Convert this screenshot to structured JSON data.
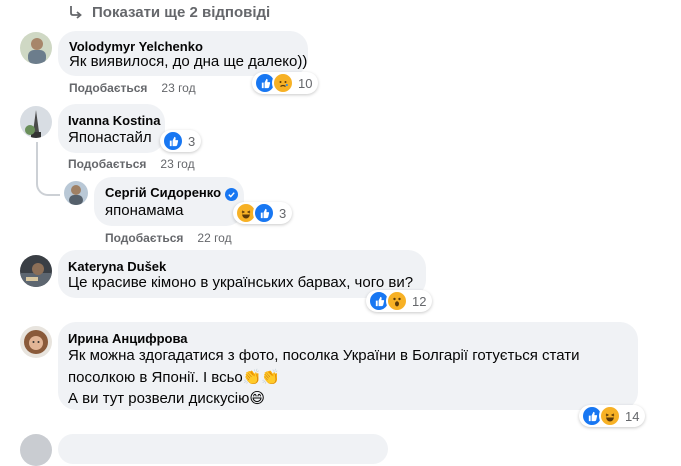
{
  "show_replies": {
    "label": "Показати ще 2 відповіді",
    "icon": "reply-arrow-icon"
  },
  "comments": [
    {
      "author": "Volodymyr Yelchenko",
      "text": "Як виявилося, до дна ще далеко))",
      "reactions": [
        "like",
        "sad"
      ],
      "count": "10",
      "like_label": "Подобається",
      "time": "23 год"
    },
    {
      "author": "Ivanna Kostina",
      "text": "Японастайл",
      "reactions": [
        "like"
      ],
      "count": "3",
      "like_label": "Подобається",
      "time": "23 год"
    },
    {
      "author": "Сергій Сидоренко",
      "verified": true,
      "text": "японамама",
      "reactions": [
        "haha",
        "like"
      ],
      "count": "3",
      "like_label": "Подобається",
      "time": "22 год"
    },
    {
      "author": "Kateryna Dušek",
      "text": "Це красиве кімоно в українських барвах, чого ви?",
      "reactions": [
        "like",
        "wow"
      ],
      "count": "12"
    },
    {
      "author": "Ирина Анцифрова",
      "text_lines": [
        "Як можна здогадатися з фото, посолка України в Болгарії готується стати",
        "посолкою в Японії. І всьо👏👏",
        "А ви тут розвели дискусію😄"
      ],
      "reactions": [
        "like",
        "haha"
      ],
      "count": "14"
    }
  ],
  "colors": {
    "bubble": "#f0f2f5",
    "meta": "#65676b",
    "like_blue": "#1877f2",
    "emoji_yellow": "#f7b125"
  }
}
